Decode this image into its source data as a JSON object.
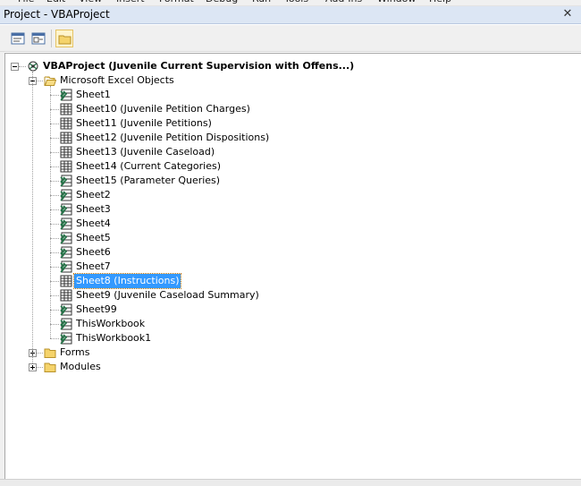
{
  "menubar": [
    "File",
    "Edit",
    "View",
    "Insert",
    "Format",
    "Debug",
    "Run",
    "Tools",
    "Add-Ins",
    "Window",
    "Help"
  ],
  "window": {
    "title": "Project - VBAProject",
    "close_glyph": "✕"
  },
  "toolbar": {
    "buttons": [
      {
        "name": "view-code-button",
        "icon": "code-view-icon"
      },
      {
        "name": "view-object-button",
        "icon": "form-view-icon"
      },
      {
        "name": "toggle-folders-button",
        "icon": "folder-icon",
        "active": true
      }
    ]
  },
  "tree": {
    "root": {
      "label": "VBAProject (Juvenile Current Supervision with Offens...)",
      "expanded": true,
      "icon": "vba-project-icon"
    },
    "folders": [
      {
        "label": "Microsoft Excel Objects",
        "expanded": true,
        "icon": "folder-open-icon"
      },
      {
        "label": "Forms",
        "expanded": false,
        "icon": "folder-icon"
      },
      {
        "label": "Modules",
        "expanded": false,
        "icon": "folder-icon"
      }
    ],
    "excel_objects": [
      {
        "label": "Sheet1",
        "icon": "sheet-hidden-icon"
      },
      {
        "label": "Sheet10 (Juvenile Petition Charges)",
        "icon": "sheet-icon"
      },
      {
        "label": "Sheet11 (Juvenile Petitions)",
        "icon": "sheet-icon"
      },
      {
        "label": "Sheet12 (Juvenile Petition Dispositions)",
        "icon": "sheet-icon"
      },
      {
        "label": "Sheet13 (Juvenile Caseload)",
        "icon": "sheet-icon"
      },
      {
        "label": "Sheet14 (Current Categories)",
        "icon": "sheet-icon"
      },
      {
        "label": "Sheet15 (Parameter Queries)",
        "icon": "sheet-hidden-icon"
      },
      {
        "label": "Sheet2",
        "icon": "sheet-hidden-icon"
      },
      {
        "label": "Sheet3",
        "icon": "sheet-hidden-icon"
      },
      {
        "label": "Sheet4",
        "icon": "sheet-hidden-icon"
      },
      {
        "label": "Sheet5",
        "icon": "sheet-hidden-icon"
      },
      {
        "label": "Sheet6",
        "icon": "sheet-hidden-icon"
      },
      {
        "label": "Sheet7",
        "icon": "sheet-hidden-icon"
      },
      {
        "label": "Sheet8 (Instructions)",
        "icon": "sheet-icon",
        "selected": true
      },
      {
        "label": "Sheet9 (Juvenile Caseload Summary)",
        "icon": "sheet-icon"
      },
      {
        "label": "Sheet99",
        "icon": "sheet-hidden-icon"
      },
      {
        "label": "ThisWorkbook",
        "icon": "sheet-hidden-icon"
      },
      {
        "label": "ThisWorkbook1",
        "icon": "sheet-hidden-icon"
      }
    ]
  },
  "colors": {
    "selection": "#3399ff",
    "titlebar": "#dce6f4",
    "folder": "#f5d36b",
    "sheet_green": "#217346"
  }
}
